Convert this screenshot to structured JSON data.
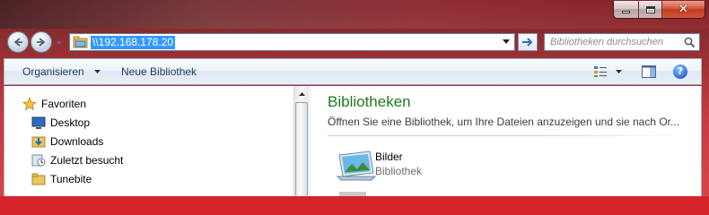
{
  "window": {
    "caption_buttons": [
      "minimize-icon",
      "maximize-icon",
      "close-icon"
    ],
    "accent_color": "#d3242a"
  },
  "navigation": {
    "back_icon": "back-arrow-icon",
    "forward_icon": "forward-arrow-icon",
    "address": "\\\\192.168.178.20",
    "search_placeholder": "Bibliotheken durchsuchen"
  },
  "toolbar": {
    "organize_label": "Organisieren",
    "new_library_label": "Neue Bibliothek",
    "help_label": "?"
  },
  "sidebar": {
    "items": [
      {
        "label": "Favoriten",
        "icon": "star-icon"
      },
      {
        "label": "Desktop",
        "icon": "desktop-icon"
      },
      {
        "label": "Downloads",
        "icon": "downloads-folder-icon"
      },
      {
        "label": "Zuletzt besucht",
        "icon": "recent-places-icon"
      },
      {
        "label": "Tunebite",
        "icon": "folder-icon"
      }
    ]
  },
  "main": {
    "title": "Bibliotheken",
    "description": "Öffnen Sie eine Bibliothek, um Ihre Dateien anzuzeigen und sie nach Or...",
    "libraries": [
      {
        "name": "Bilder",
        "type": "Bibliothek",
        "icon": "pictures-library-icon"
      }
    ]
  },
  "colors": {
    "title_green": "#1d7a22",
    "selection_blue": "#3399ff",
    "command_text": "#1e395b"
  }
}
